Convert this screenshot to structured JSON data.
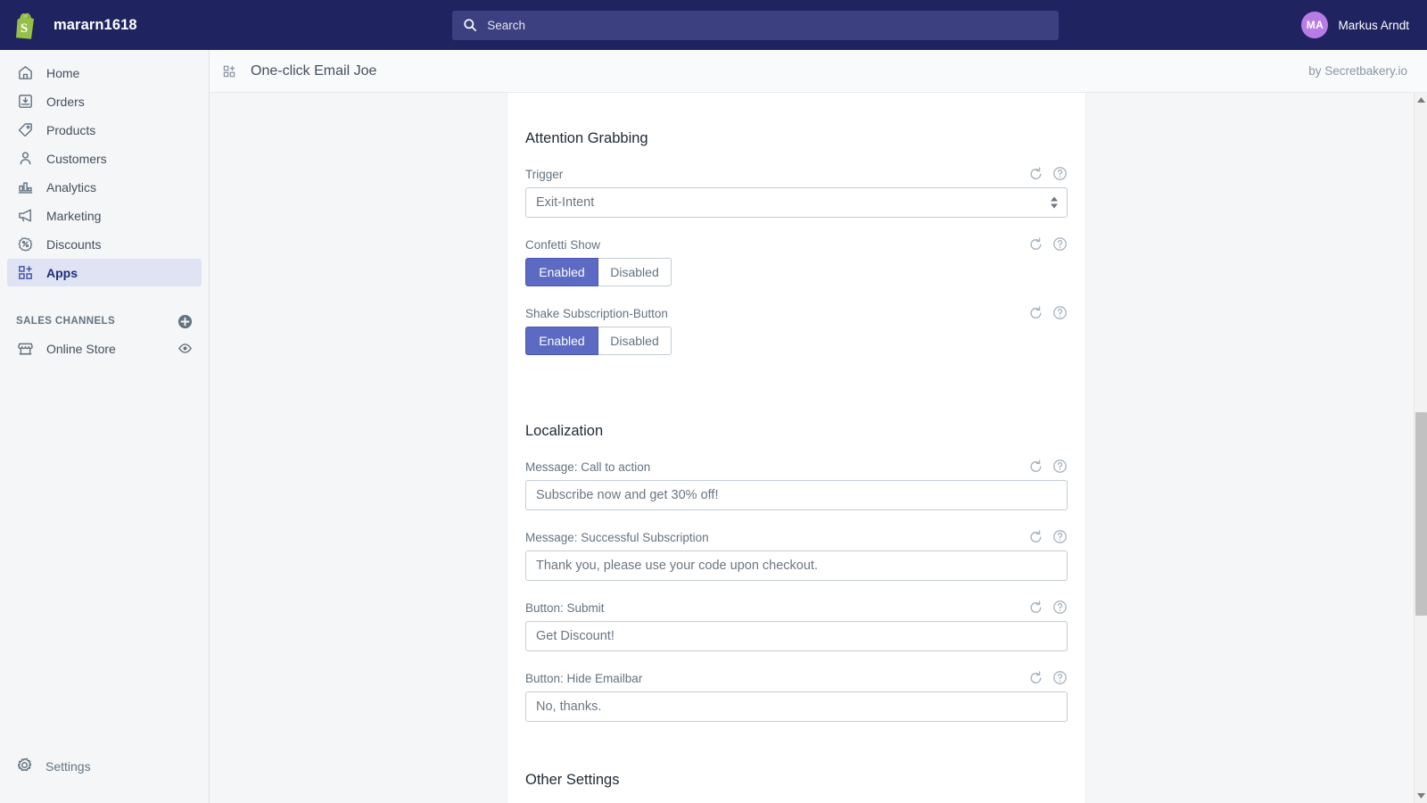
{
  "topbar": {
    "store_name": "mararn1618",
    "logo_icon": "shopify-bag-icon",
    "search": {
      "icon": "search-icon",
      "placeholder": "Search",
      "value": ""
    },
    "user": {
      "initials": "MA",
      "name": "Markus Arndt"
    }
  },
  "sidebar": {
    "items": [
      {
        "label": "Home",
        "icon": "home-icon",
        "active": false
      },
      {
        "label": "Orders",
        "icon": "orders-icon",
        "active": false
      },
      {
        "label": "Products",
        "icon": "products-tag-icon",
        "active": false
      },
      {
        "label": "Customers",
        "icon": "customers-person-icon",
        "active": false
      },
      {
        "label": "Analytics",
        "icon": "analytics-bars-icon",
        "active": false
      },
      {
        "label": "Marketing",
        "icon": "marketing-megaphone-icon",
        "active": false
      },
      {
        "label": "Discounts",
        "icon": "discounts-percent-icon",
        "active": false
      },
      {
        "label": "Apps",
        "icon": "apps-grid-plus-icon",
        "active": true
      }
    ],
    "sales_channels": {
      "heading": "SALES CHANNELS",
      "add_icon": "plus-circle-icon",
      "items": [
        {
          "label": "Online Store",
          "icon": "storefront-icon",
          "trailing_icon": "eye-icon"
        }
      ]
    },
    "settings": {
      "label": "Settings",
      "icon": "gear-icon"
    }
  },
  "app_header": {
    "app_icon": "apps-grid-plus-icon",
    "title": "One-click Email Joe",
    "credit": "by Secretbakery.io"
  },
  "sections": [
    {
      "title": "Attention Grabbing",
      "fields": [
        {
          "label": "Trigger",
          "type": "select",
          "value": "Exit-Intent",
          "options": [
            "Exit-Intent"
          ],
          "reset_icon": "reset-arrow-icon",
          "help_icon": "help-circle-icon"
        },
        {
          "label": "Confetti Show",
          "type": "segmented",
          "options": [
            "Enabled",
            "Disabled"
          ],
          "value": "Enabled",
          "reset_icon": "reset-arrow-icon",
          "help_icon": "help-circle-icon"
        },
        {
          "label": "Shake Subscription-Button",
          "type": "segmented",
          "options": [
            "Enabled",
            "Disabled"
          ],
          "value": "Enabled",
          "reset_icon": "reset-arrow-icon",
          "help_icon": "help-circle-icon"
        }
      ]
    },
    {
      "title": "Localization",
      "fields": [
        {
          "label": "Message: Call to action",
          "type": "text",
          "value": "Subscribe now and get 30% off!",
          "reset_icon": "reset-arrow-icon",
          "help_icon": "help-circle-icon"
        },
        {
          "label": "Message: Successful Subscription",
          "type": "text",
          "value": "Thank you, please use your code upon checkout.",
          "reset_icon": "reset-arrow-icon",
          "help_icon": "help-circle-icon"
        },
        {
          "label": "Button: Submit",
          "type": "text",
          "value": "Get Discount!",
          "reset_icon": "reset-arrow-icon",
          "help_icon": "help-circle-icon"
        },
        {
          "label": "Button: Hide Emailbar",
          "type": "text",
          "value": "No, thanks.",
          "reset_icon": "reset-arrow-icon",
          "help_icon": "help-circle-icon"
        }
      ]
    },
    {
      "title": "Other Settings",
      "fields": []
    }
  ],
  "scrollbar": {
    "up_icon": "scroll-up-arrow-icon",
    "down_icon": "scroll-down-arrow-icon",
    "thumb": "scrollbar-thumb"
  },
  "colors": {
    "topbar_bg": "#1f2360",
    "accent": "#5c6ac4",
    "sidebar_active_bg": "#dfe3f3",
    "avatar_bg": "#b87ce6",
    "page_bg": "#f4f6f8"
  }
}
